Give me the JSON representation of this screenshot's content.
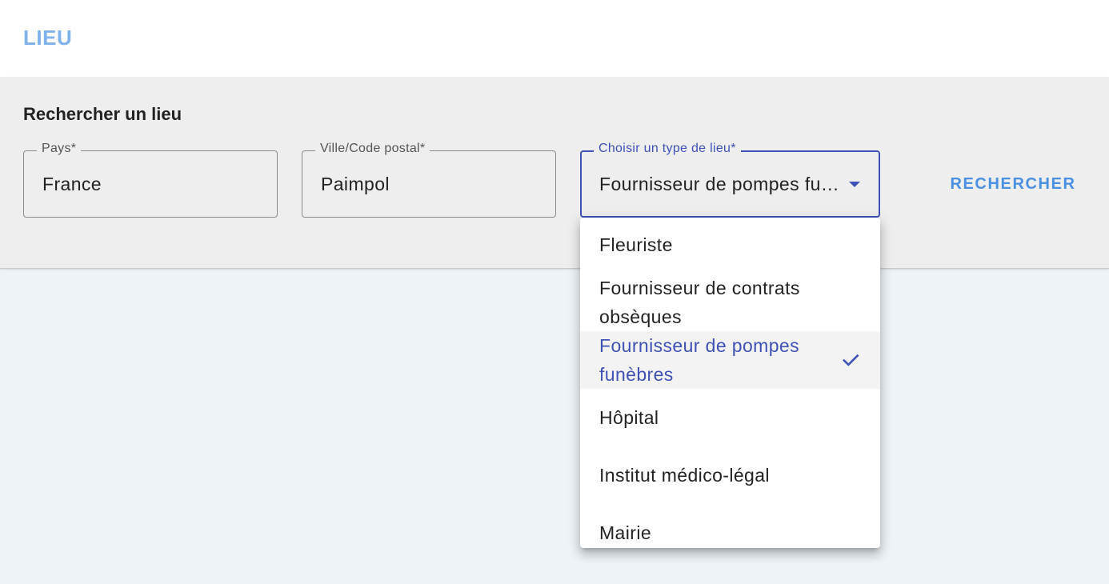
{
  "header": {
    "title": "LIEU"
  },
  "search": {
    "title": "Rechercher un lieu",
    "fields": {
      "country": {
        "label": "Pays*",
        "value": "France"
      },
      "city": {
        "label": "Ville/Code postal*",
        "value": "Paimpol"
      },
      "place_type": {
        "label": "Choisir un type de lieu*",
        "value": "Fournisseur de pompes funèbres",
        "caret_icon": "arrow-drop-down-icon"
      }
    },
    "button_label": "RECHERCHER"
  },
  "dropdown": {
    "options": [
      "Fleuriste",
      "Fournisseur de contrats obsèques",
      "Fournisseur de pompes funèbres",
      "Hôpital",
      "Institut médico-légal",
      "Mairie"
    ],
    "selected_index": 2,
    "selected_icon": "check-icon"
  },
  "colors": {
    "accent": "#3f51b5",
    "link_blue": "#4a90e2",
    "title_blue": "#7fb2ea",
    "panel_bg": "#eeeeee",
    "page_bg": "#eef3f7"
  }
}
